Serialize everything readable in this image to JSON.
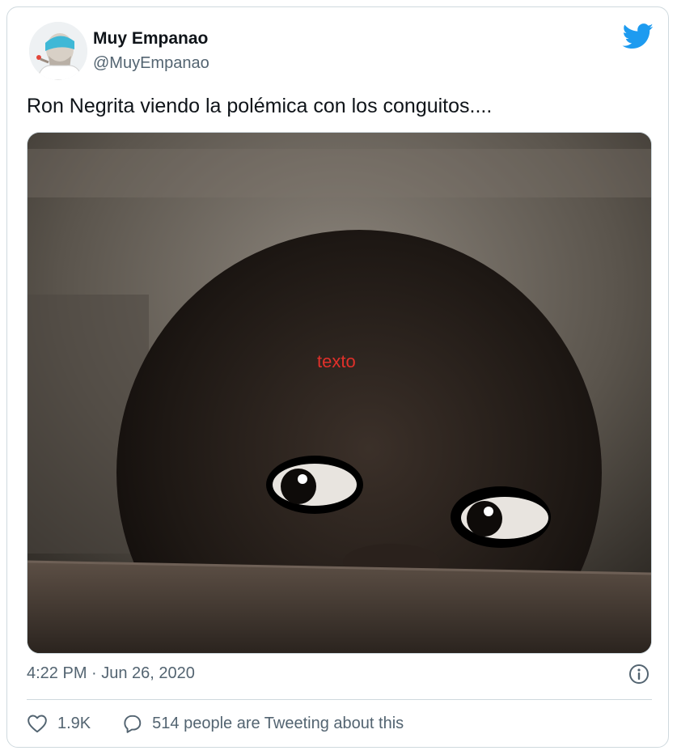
{
  "tweet": {
    "author_name": "Muy Empanao",
    "author_handle": "@MuyEmpanao",
    "text": "Ron Negrita viendo la polémica con los conguitos....",
    "media_overlay_text": "texto",
    "timestamp": "4:22 PM · Jun 26, 2020"
  },
  "actions": {
    "likes_count": "1.9K",
    "conversation_label": "514 people are Tweeting about this"
  },
  "icons": {
    "brand": "twitter-bird-icon",
    "info": "info-icon",
    "like": "heart-icon",
    "reply": "speech-bubble-icon"
  },
  "colors": {
    "twitter_blue": "#1d9bf0",
    "overlay_text_red": "#e0302a",
    "secondary_text": "#536471"
  }
}
